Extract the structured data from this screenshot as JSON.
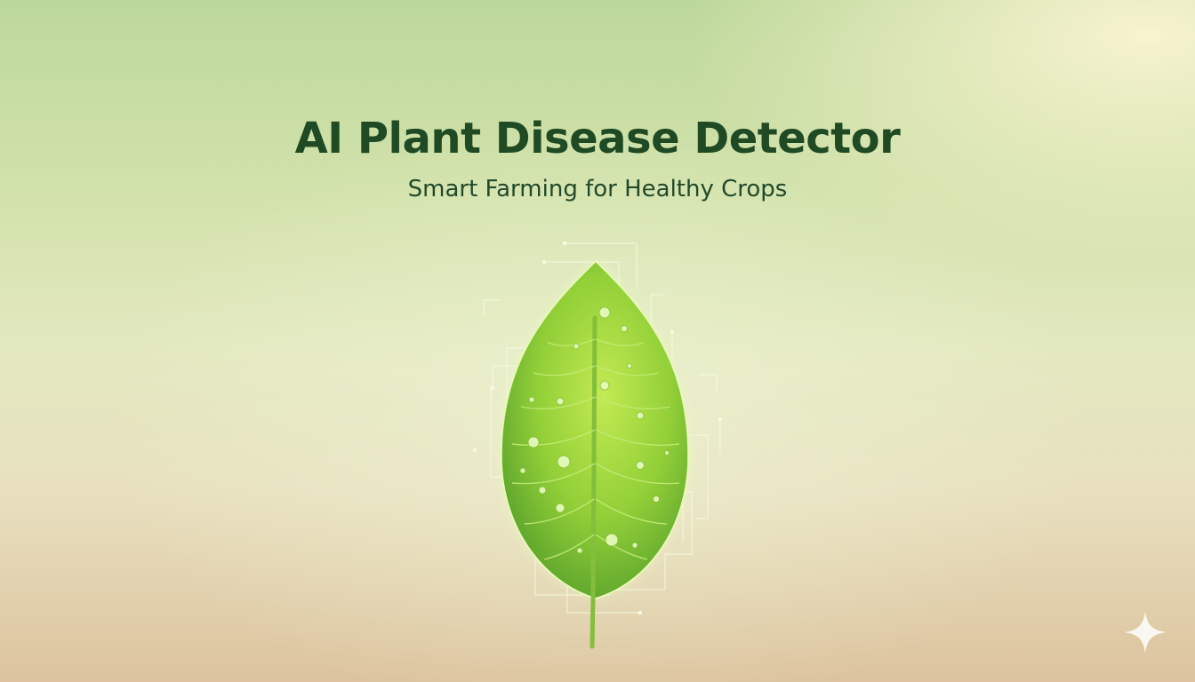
{
  "hero": {
    "title": "AI Plant Disease Detector",
    "subtitle": "Smart Farming for Healthy Crops"
  },
  "illustration": {
    "icon": "leaf-icon",
    "decoration_icon": "sparkle-icon"
  },
  "colors": {
    "title": "#1f4a23",
    "leaf_light": "#b7e24a",
    "leaf_dark": "#5fa52c",
    "background_top": "#bcd79a",
    "background_bottom": "#dcc39e"
  }
}
